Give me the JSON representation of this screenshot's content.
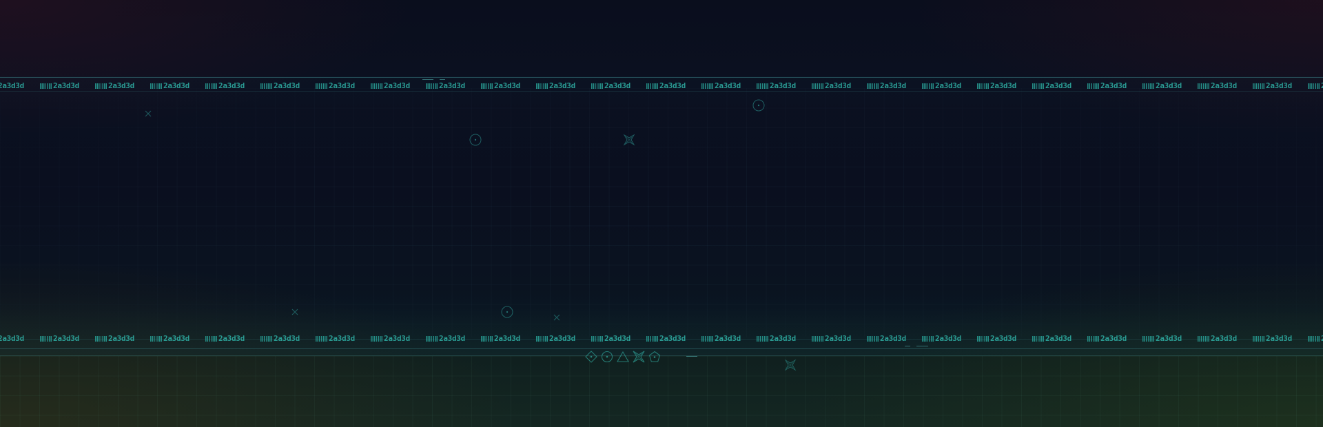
{
  "background": {
    "base_color": "#080c17",
    "accent_color": "#28a096",
    "line_color": "#38787d",
    "grid_color": "#46788c"
  },
  "ticker": {
    "unit_label": "2a3d3d",
    "icon": "barcode-icon"
  },
  "info_panel": {
    "lines": [
      "",
      "",
      "",
      ""
    ]
  },
  "shape_icons": [
    "diamond-icon",
    "circle-dot-icon",
    "triangle-icon",
    "four-point-star-icon",
    "pentagon-icon"
  ],
  "floating_marks": [
    "cross-icon",
    "target-circle-icon",
    "four-point-star-icon",
    "target-circle-icon",
    "cross-icon",
    "target-circle-icon",
    "cross-icon",
    "four-point-star-icon"
  ]
}
